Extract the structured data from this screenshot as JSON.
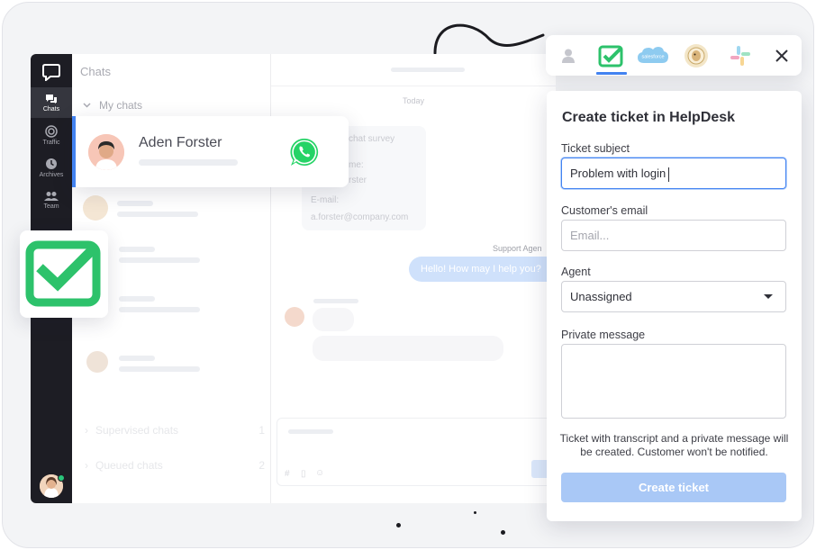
{
  "nav": {
    "items": [
      {
        "label": "Chats",
        "icon": "chats-icon"
      },
      {
        "label": "Traffic",
        "icon": "traffic-icon"
      },
      {
        "label": "Archives",
        "icon": "archives-icon"
      },
      {
        "label": "Team",
        "icon": "team-icon"
      }
    ]
  },
  "list": {
    "title": "Chats",
    "my_chats_label": "My chats",
    "supervised_label": "Supervised chats",
    "supervised_count": "1",
    "queued_label": "Queued chats",
    "queued_count": "2"
  },
  "card": {
    "name": "Aden Forster",
    "channel_icon": "whatsapp-icon"
  },
  "conversation": {
    "date_divider": "Today",
    "survey_title": "chat survey",
    "survey_name_label": "me:",
    "survey_name_value": "rster",
    "survey_email_label": "E-mail:",
    "survey_email_value": "a.forster@company.com",
    "agent_label": "Support Agen",
    "agent_message": "Hello! How may I help you?"
  },
  "integrations": {
    "items": [
      "user-icon",
      "helpdesk-icon",
      "salesforce-icon",
      "mailchimp-icon",
      "slack-icon"
    ],
    "salesforce_text": "salesforce",
    "close_label": "×"
  },
  "ticket_form": {
    "title": "Create ticket in HelpDesk",
    "subject_label": "Ticket subject",
    "subject_value": "Problem with login",
    "email_label": "Customer's email",
    "email_placeholder": "Email...",
    "agent_label": "Agent",
    "agent_value": "Unassigned",
    "message_label": "Private message",
    "note": "Ticket with transcript and a private message will be created. Customer won't be notified.",
    "submit_label": "Create ticket"
  },
  "colors": {
    "accent": "#4383f1",
    "helpdesk_green": "#2dc26b",
    "whatsapp_green": "#25d366",
    "submit_disabled": "#a9c8f6",
    "nav_dark": "#1d1d24"
  }
}
